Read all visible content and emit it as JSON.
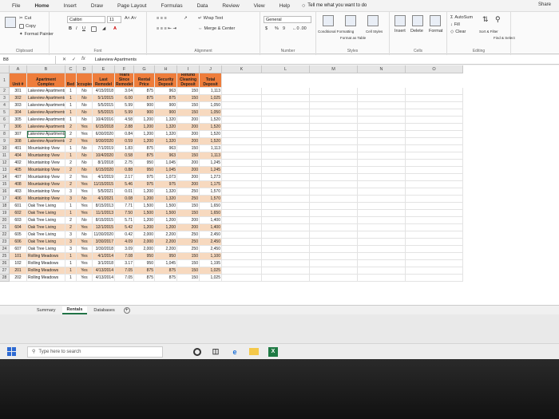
{
  "tabs": [
    "File",
    "Home",
    "Insert",
    "Draw",
    "Page Layout",
    "Formulas",
    "Data",
    "Review",
    "View",
    "Help"
  ],
  "tell_me": "Tell me what you want to do",
  "share": "Share",
  "ribbon": {
    "clipboard": {
      "cut": "Cut",
      "copy": "Copy",
      "format_painter": "Format Painter",
      "name": "Clipboard"
    },
    "font": {
      "font_name": "Calibri",
      "font_size": "11",
      "bold": "B",
      "italic": "I",
      "underline": "U",
      "name": "Font"
    },
    "alignment": {
      "wrap_text": "Wrap Text",
      "merge_center": "Merge & Center",
      "name": "Alignment"
    },
    "number": {
      "format": "General",
      "currency": "$",
      "percent": "%",
      "comma": "9",
      "name": "Number"
    },
    "styles": {
      "conditional": "Conditional Formatting",
      "format_as_table": "Format as Table",
      "cell_styles": "Cell Styles",
      "name": "Styles"
    },
    "cells": {
      "insert": "Insert",
      "delete": "Delete",
      "format": "Format",
      "name": "Cells"
    },
    "editing": {
      "autosum": "AutoSum",
      "fill": "Fill",
      "clear": "Clear",
      "sort_filter": "Sort & Filter",
      "find_select": "Find & Select",
      "name": "Editing"
    }
  },
  "formula_bar": {
    "name_box": "B8",
    "fx": "fx",
    "content": "Lakeview Apartments"
  },
  "columns": [
    "A",
    "B",
    "C",
    "D",
    "E",
    "F",
    "G",
    "H",
    "I",
    "J",
    "K",
    "L",
    "M",
    "N",
    "O"
  ],
  "table": {
    "headers": [
      "Unit #",
      "Apartment Complex",
      "Bed",
      "Occupied",
      "Last Remodel",
      "Years Since Remodel",
      "Rental Price",
      "Security Deposit",
      "Non-Refund Cleaning Deposit",
      "Total Deposit"
    ],
    "rows": [
      [
        "301",
        "Lakeview Apartments",
        "1",
        "No",
        "4/15/2018",
        "3.04",
        "875",
        "963",
        "150",
        "1,113"
      ],
      [
        "302",
        "Lakeview Apartments",
        "1",
        "No",
        "5/1/2015",
        "6.00",
        "875",
        "875",
        "150",
        "1,025"
      ],
      [
        "303",
        "Lakeview Apartments",
        "1",
        "No",
        "5/5/2015",
        "5.99",
        "900",
        "900",
        "150",
        "1,050"
      ],
      [
        "304",
        "Lakeview Apartments",
        "1",
        "No",
        "5/5/2015",
        "5.99",
        "900",
        "900",
        "150",
        "1,050"
      ],
      [
        "305",
        "Lakeview Apartments",
        "1",
        "No",
        "10/4/2016",
        "4.58",
        "1,200",
        "1,320",
        "200",
        "1,520"
      ],
      [
        "306",
        "Lakeview Apartments",
        "2",
        "Yes",
        "6/15/2018",
        "2.88",
        "1,200",
        "1,320",
        "200",
        "1,520"
      ],
      [
        "307",
        "Lakeview Apartments",
        "2",
        "Yes",
        "6/30/2020",
        "0.84",
        "1,200",
        "1,320",
        "200",
        "1,520"
      ],
      [
        "308",
        "Lakeview Apartments",
        "2",
        "Yes",
        "9/30/2020",
        "0.59",
        "1,200",
        "1,320",
        "200",
        "1,520"
      ],
      [
        "401",
        "Mountaintop View",
        "1",
        "No",
        "7/1/2019",
        "1.83",
        "875",
        "963",
        "150",
        "1,113"
      ],
      [
        "404",
        "Mountaintop View",
        "1",
        "No",
        "10/4/2020",
        "0.58",
        "875",
        "963",
        "150",
        "1,113"
      ],
      [
        "402",
        "Mountaintop View",
        "2",
        "No",
        "8/1/2018",
        "2.75",
        "950",
        "1,045",
        "200",
        "1,245"
      ],
      [
        "405",
        "Mountaintop View",
        "2",
        "No",
        "6/15/2020",
        "0.88",
        "950",
        "1,045",
        "200",
        "1,245"
      ],
      [
        "407",
        "Mountaintop View",
        "2",
        "Yes",
        "4/1/2019",
        "2.17",
        "975",
        "1,073",
        "200",
        "1,273"
      ],
      [
        "408",
        "Mountaintop View",
        "2",
        "Yes",
        "11/15/2015",
        "5.46",
        "975",
        "975",
        "200",
        "1,175"
      ],
      [
        "403",
        "Mountaintop View",
        "3",
        "Yes",
        "5/5/2021",
        "0.01",
        "1,200",
        "1,320",
        "250",
        "1,570"
      ],
      [
        "406",
        "Mountaintop View",
        "3",
        "No",
        "4/1/2021",
        "0.08",
        "1,200",
        "1,320",
        "250",
        "1,570"
      ],
      [
        "601",
        "Oak Tree Living",
        "1",
        "Yes",
        "8/15/2013",
        "7.71",
        "1,500",
        "1,500",
        "150",
        "1,650"
      ],
      [
        "602",
        "Oak Tree Living",
        "1",
        "Yes",
        "11/1/2013",
        "7.50",
        "1,500",
        "1,500",
        "150",
        "1,650"
      ],
      [
        "603",
        "Oak Tree Living",
        "2",
        "No",
        "8/15/2015",
        "5.71",
        "1,200",
        "1,200",
        "200",
        "1,400"
      ],
      [
        "604",
        "Oak Tree Living",
        "2",
        "Yes",
        "12/1/2015",
        "5.42",
        "1,200",
        "1,200",
        "200",
        "1,400"
      ],
      [
        "605",
        "Oak Tree Living",
        "3",
        "No",
        "11/30/2020",
        "0.42",
        "2,000",
        "2,200",
        "250",
        "2,450"
      ],
      [
        "606",
        "Oak Tree Living",
        "3",
        "Yes",
        "3/30/2017",
        "4.09",
        "2,000",
        "2,200",
        "250",
        "2,450"
      ],
      [
        "607",
        "Oak Tree Living",
        "3",
        "Yes",
        "3/30/2018",
        "3.09",
        "2,000",
        "2,200",
        "250",
        "2,450"
      ],
      [
        "101",
        "Rolling Meadows",
        "1",
        "Yes",
        "4/1/2014",
        "7.08",
        "950",
        "950",
        "150",
        "1,100"
      ],
      [
        "102",
        "Rolling Meadows",
        "1",
        "Yes",
        "3/1/2018",
        "3.17",
        "950",
        "1,045",
        "150",
        "1,195"
      ],
      [
        "201",
        "Rolling Meadows",
        "1",
        "Yes",
        "4/13/2014",
        "7.05",
        "875",
        "875",
        "150",
        "1,025"
      ],
      [
        "202",
        "Rolling Meadows",
        "1",
        "Yes",
        "4/13/2014",
        "7.05",
        "875",
        "875",
        "150",
        "1,025"
      ]
    ]
  },
  "sheets": [
    "Summary",
    "Rentals",
    "Databases"
  ],
  "active_sheet": "Rentals",
  "taskbar": {
    "search_placeholder": "Type here to search"
  }
}
